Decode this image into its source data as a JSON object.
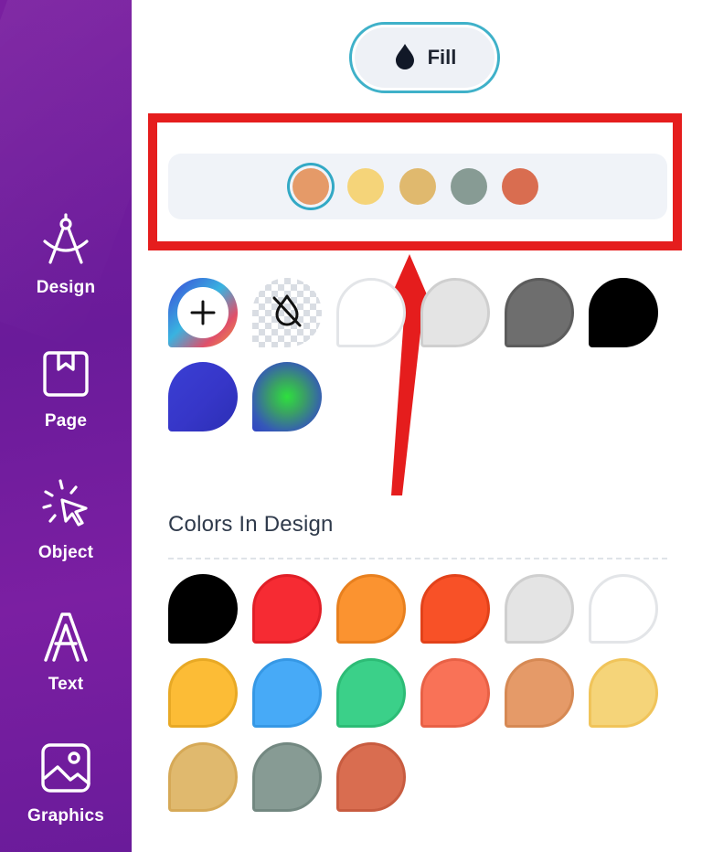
{
  "sidebar": {
    "items": [
      {
        "label": "Design",
        "icon": "compass-icon"
      },
      {
        "label": "Page",
        "icon": "page-bookmark-icon"
      },
      {
        "label": "Object",
        "icon": "cursor-click-icon"
      },
      {
        "label": "Text",
        "icon": "text-a-icon"
      },
      {
        "label": "Graphics",
        "icon": "image-icon"
      }
    ]
  },
  "fill_button": {
    "label": "Fill",
    "icon": "droplet-icon"
  },
  "palette": {
    "selected_index": 0,
    "colors": [
      "#e59a68",
      "#f5d479",
      "#e0b96e",
      "#879b94",
      "#d96d50"
    ]
  },
  "swatches": {
    "custom_icon": "plus-icon",
    "transparent_icon": "no-fill-droplet-icon",
    "solid": [
      {
        "fill": "#ffffff",
        "border": "#e3e5e8"
      },
      {
        "fill": "#e4e4e4",
        "border": "#cfcfcf"
      },
      {
        "fill": "#6e6e6e",
        "border": "#5c5c5c"
      },
      {
        "fill": "#000000",
        "border": "#000000"
      }
    ]
  },
  "colors_in_design": {
    "title": "Colors In Design",
    "swatches": [
      {
        "fill": "#000000",
        "border": "#000000"
      },
      {
        "fill": "#f62b33",
        "border": "#e01f27"
      },
      {
        "fill": "#fb9330",
        "border": "#e8801f"
      },
      {
        "fill": "#f85127",
        "border": "#e2421a"
      },
      {
        "fill": "#e4e4e4",
        "border": "#cfcfcf"
      },
      {
        "fill": "#ffffff",
        "border": "#e3e5e8"
      },
      {
        "fill": "#fcbc36",
        "border": "#e8a925"
      },
      {
        "fill": "#47aaf7",
        "border": "#3698e5"
      },
      {
        "fill": "#3bd089",
        "border": "#2dbc76"
      },
      {
        "fill": "#f97257",
        "border": "#e86146"
      },
      {
        "fill": "#e59a68",
        "border": "#d68954"
      },
      {
        "fill": "#f5d479",
        "border": "#f0c45a"
      },
      {
        "fill": "#e0b96e",
        "border": "#d6a957"
      },
      {
        "fill": "#879b94",
        "border": "#738881"
      },
      {
        "fill": "#d96d50",
        "border": "#c85c40"
      }
    ]
  },
  "annotation": {
    "highlight_color": "#e51d1d"
  }
}
